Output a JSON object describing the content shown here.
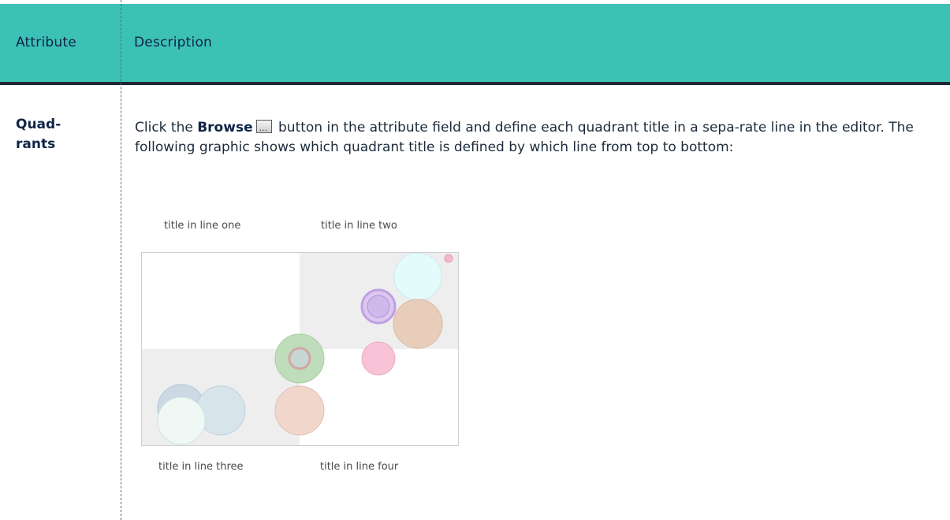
{
  "table": {
    "headers": {
      "attribute": "Attribute",
      "description": "Description"
    },
    "rows": [
      {
        "attribute": "Quad-\nrants",
        "description": {
          "prefix": "Click the ",
          "bold": "Browse",
          "suffix": " button in the attribute field and define each quadrant title in a sepa-rate line in the editor. The following graphic shows which quadrant title is defined by which line from top to bottom:"
        }
      }
    ]
  },
  "graphic": {
    "labels": {
      "top_left": "title in line one",
      "top_right": "title in line two",
      "bottom_left": "title in line three",
      "bottom_right": "title in line four"
    }
  },
  "colors": {
    "header_bg": "#3cc1b5",
    "header_text": "#0f2547",
    "rule": "#1f2633"
  },
  "icons": {
    "browse": "ellipsis-button-icon"
  }
}
